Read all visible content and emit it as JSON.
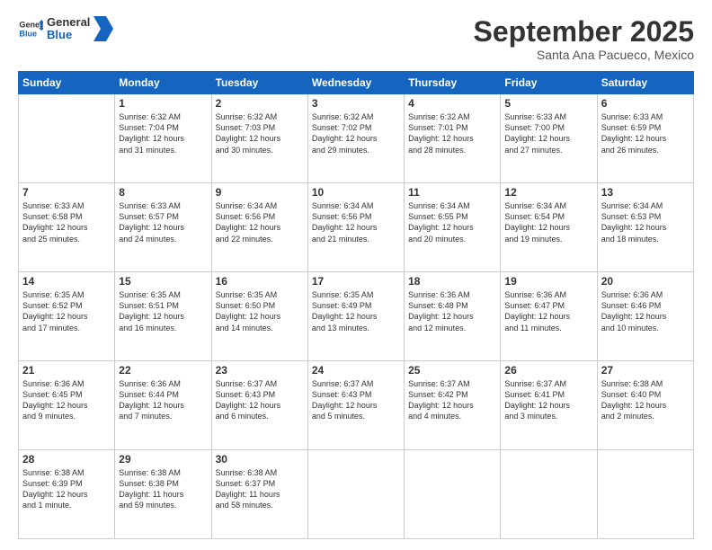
{
  "header": {
    "logo_line1": "General",
    "logo_line2": "Blue",
    "month": "September 2025",
    "location": "Santa Ana Pacueco, Mexico"
  },
  "weekdays": [
    "Sunday",
    "Monday",
    "Tuesday",
    "Wednesday",
    "Thursday",
    "Friday",
    "Saturday"
  ],
  "weeks": [
    [
      {
        "day": "",
        "text": ""
      },
      {
        "day": "1",
        "text": "Sunrise: 6:32 AM\nSunset: 7:04 PM\nDaylight: 12 hours\nand 31 minutes."
      },
      {
        "day": "2",
        "text": "Sunrise: 6:32 AM\nSunset: 7:03 PM\nDaylight: 12 hours\nand 30 minutes."
      },
      {
        "day": "3",
        "text": "Sunrise: 6:32 AM\nSunset: 7:02 PM\nDaylight: 12 hours\nand 29 minutes."
      },
      {
        "day": "4",
        "text": "Sunrise: 6:32 AM\nSunset: 7:01 PM\nDaylight: 12 hours\nand 28 minutes."
      },
      {
        "day": "5",
        "text": "Sunrise: 6:33 AM\nSunset: 7:00 PM\nDaylight: 12 hours\nand 27 minutes."
      },
      {
        "day": "6",
        "text": "Sunrise: 6:33 AM\nSunset: 6:59 PM\nDaylight: 12 hours\nand 26 minutes."
      }
    ],
    [
      {
        "day": "7",
        "text": "Sunrise: 6:33 AM\nSunset: 6:58 PM\nDaylight: 12 hours\nand 25 minutes."
      },
      {
        "day": "8",
        "text": "Sunrise: 6:33 AM\nSunset: 6:57 PM\nDaylight: 12 hours\nand 24 minutes."
      },
      {
        "day": "9",
        "text": "Sunrise: 6:34 AM\nSunset: 6:56 PM\nDaylight: 12 hours\nand 22 minutes."
      },
      {
        "day": "10",
        "text": "Sunrise: 6:34 AM\nSunset: 6:56 PM\nDaylight: 12 hours\nand 21 minutes."
      },
      {
        "day": "11",
        "text": "Sunrise: 6:34 AM\nSunset: 6:55 PM\nDaylight: 12 hours\nand 20 minutes."
      },
      {
        "day": "12",
        "text": "Sunrise: 6:34 AM\nSunset: 6:54 PM\nDaylight: 12 hours\nand 19 minutes."
      },
      {
        "day": "13",
        "text": "Sunrise: 6:34 AM\nSunset: 6:53 PM\nDaylight: 12 hours\nand 18 minutes."
      }
    ],
    [
      {
        "day": "14",
        "text": "Sunrise: 6:35 AM\nSunset: 6:52 PM\nDaylight: 12 hours\nand 17 minutes."
      },
      {
        "day": "15",
        "text": "Sunrise: 6:35 AM\nSunset: 6:51 PM\nDaylight: 12 hours\nand 16 minutes."
      },
      {
        "day": "16",
        "text": "Sunrise: 6:35 AM\nSunset: 6:50 PM\nDaylight: 12 hours\nand 14 minutes."
      },
      {
        "day": "17",
        "text": "Sunrise: 6:35 AM\nSunset: 6:49 PM\nDaylight: 12 hours\nand 13 minutes."
      },
      {
        "day": "18",
        "text": "Sunrise: 6:36 AM\nSunset: 6:48 PM\nDaylight: 12 hours\nand 12 minutes."
      },
      {
        "day": "19",
        "text": "Sunrise: 6:36 AM\nSunset: 6:47 PM\nDaylight: 12 hours\nand 11 minutes."
      },
      {
        "day": "20",
        "text": "Sunrise: 6:36 AM\nSunset: 6:46 PM\nDaylight: 12 hours\nand 10 minutes."
      }
    ],
    [
      {
        "day": "21",
        "text": "Sunrise: 6:36 AM\nSunset: 6:45 PM\nDaylight: 12 hours\nand 9 minutes."
      },
      {
        "day": "22",
        "text": "Sunrise: 6:36 AM\nSunset: 6:44 PM\nDaylight: 12 hours\nand 7 minutes."
      },
      {
        "day": "23",
        "text": "Sunrise: 6:37 AM\nSunset: 6:43 PM\nDaylight: 12 hours\nand 6 minutes."
      },
      {
        "day": "24",
        "text": "Sunrise: 6:37 AM\nSunset: 6:43 PM\nDaylight: 12 hours\nand 5 minutes."
      },
      {
        "day": "25",
        "text": "Sunrise: 6:37 AM\nSunset: 6:42 PM\nDaylight: 12 hours\nand 4 minutes."
      },
      {
        "day": "26",
        "text": "Sunrise: 6:37 AM\nSunset: 6:41 PM\nDaylight: 12 hours\nand 3 minutes."
      },
      {
        "day": "27",
        "text": "Sunrise: 6:38 AM\nSunset: 6:40 PM\nDaylight: 12 hours\nand 2 minutes."
      }
    ],
    [
      {
        "day": "28",
        "text": "Sunrise: 6:38 AM\nSunset: 6:39 PM\nDaylight: 12 hours\nand 1 minute."
      },
      {
        "day": "29",
        "text": "Sunrise: 6:38 AM\nSunset: 6:38 PM\nDaylight: 11 hours\nand 59 minutes."
      },
      {
        "day": "30",
        "text": "Sunrise: 6:38 AM\nSunset: 6:37 PM\nDaylight: 11 hours\nand 58 minutes."
      },
      {
        "day": "",
        "text": ""
      },
      {
        "day": "",
        "text": ""
      },
      {
        "day": "",
        "text": ""
      },
      {
        "day": "",
        "text": ""
      }
    ]
  ]
}
